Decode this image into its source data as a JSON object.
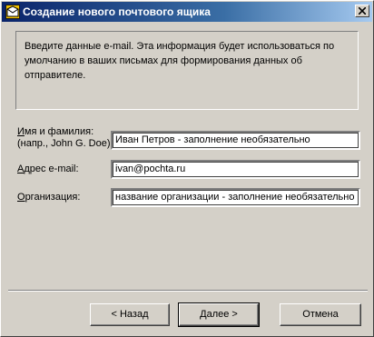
{
  "window": {
    "title": "Создание нового почтового ящика"
  },
  "info": {
    "text": "Введите данные e-mail. Эта информация будет использоваться по умолчанию в ваших письмах для формирования данных об отправителе."
  },
  "form": {
    "name_label_line1": "Имя и фамилия:",
    "name_label_line2": "(напр., John G. Doe)",
    "name_value": "Иван Петров - заполнение необязательно",
    "email_label": "Адрес e-mail:",
    "email_value": "ivan@pochta.ru",
    "org_label": "Организация:",
    "org_value": "название организации - заполнение необязательно"
  },
  "buttons": {
    "back": "<  Назад",
    "next": "Далее  >",
    "cancel": "Отмена"
  }
}
